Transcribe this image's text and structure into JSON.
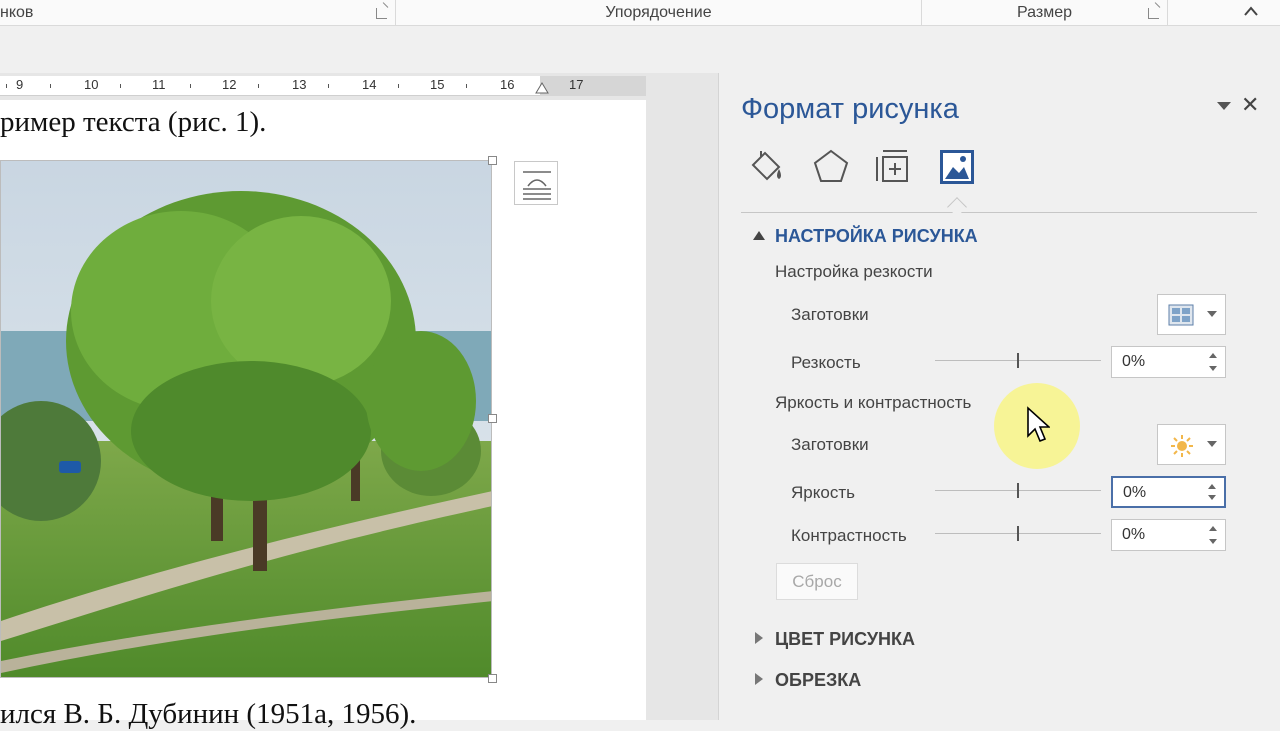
{
  "ribbon": {
    "group_partial": "нков",
    "group_arrange": "Упорядочение",
    "group_size": "Размер"
  },
  "ruler": {
    "numbers": [
      "9",
      "10",
      "11",
      "12",
      "13",
      "14",
      "15",
      "16",
      "17"
    ]
  },
  "document": {
    "line_top": "ример текста (рис. 1).",
    "line_bottom": "ился В. Б. Дубинин (1951а, 1956)."
  },
  "pane": {
    "title": "Формат рисунка",
    "close_glyph": "✕",
    "tabs": [
      {
        "icon": "paint-bucket-icon",
        "label": "Заливка и границы"
      },
      {
        "icon": "pentagon-icon",
        "label": "Эффекты"
      },
      {
        "icon": "layout-size-icon",
        "label": "Макет и свойства"
      },
      {
        "icon": "picture-icon",
        "label": "Рисунок",
        "active": true
      }
    ],
    "section_picture_settings": "НАСТРОЙКА РИСУНКА",
    "sharpness_heading": "Настройка резкости",
    "presets_label_1": "Заготовки",
    "sharpness_label": "Резкость",
    "sharpness_value": "0%",
    "brightness_contrast_heading": "Яркость и контрастность",
    "presets_label_2": "Заготовки",
    "brightness_label": "Яркость",
    "brightness_value": "0%",
    "contrast_label": "Контрастность",
    "contrast_value": "0%",
    "reset_label": "Сброс",
    "section_picture_color": "ЦВЕТ РИСУНКА",
    "section_crop": "ОБРЕЗКА"
  },
  "colors": {
    "accent": "#2b5797",
    "cursor_halo": "#faf578"
  }
}
